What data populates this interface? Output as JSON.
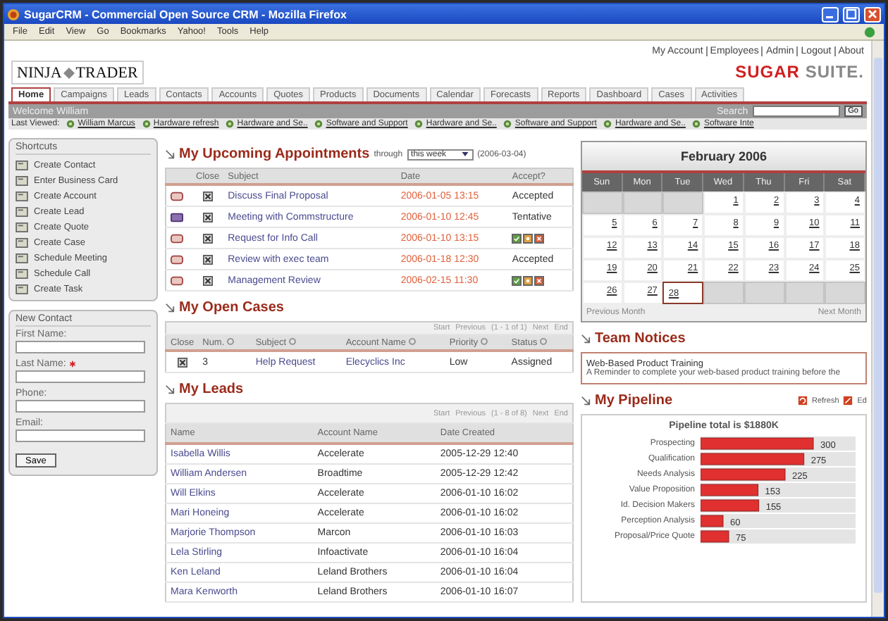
{
  "window": {
    "title": "SugarCRM - Commercial Open Source CRM - Mozilla Firefox"
  },
  "menu": [
    "File",
    "Edit",
    "View",
    "Go",
    "Bookmarks",
    "Yahoo!",
    "Tools",
    "Help"
  ],
  "logo": {
    "left": "NINJA",
    "right": "TRADER"
  },
  "header_links": [
    "My Account",
    "Employees",
    "Admin",
    "Logout",
    "About"
  ],
  "brand": {
    "strong": "SUGAR",
    "light": "SUITE."
  },
  "tabs": [
    {
      "label": "Home",
      "selected": true
    },
    {
      "label": "Campaigns",
      "selected": false
    },
    {
      "label": "Leads",
      "selected": false
    },
    {
      "label": "Contacts",
      "selected": false
    },
    {
      "label": "Accounts",
      "selected": false
    },
    {
      "label": "Quotes",
      "selected": false
    },
    {
      "label": "Products",
      "selected": false
    },
    {
      "label": "Documents",
      "selected": false
    },
    {
      "label": "Calendar",
      "selected": false
    },
    {
      "label": "Forecasts",
      "selected": false
    },
    {
      "label": "Reports",
      "selected": false
    },
    {
      "label": "Dashboard",
      "selected": false
    },
    {
      "label": "Cases",
      "selected": false
    },
    {
      "label": "Activities",
      "selected": false
    }
  ],
  "welcome": {
    "text": "Welcome William",
    "search_label": "Search",
    "go": "Go"
  },
  "last_viewed": {
    "label": "Last Viewed:",
    "items": [
      "William Marcus",
      "Hardware refresh",
      "Hardware and Se..",
      "Software and Support",
      "Hardware and Se..",
      "Software and Support",
      "Hardware and Se..",
      "Software Inte"
    ]
  },
  "shortcuts": {
    "title": "Shortcuts",
    "items": [
      "Create Contact",
      "Enter Business Card",
      "Create Account",
      "Create Lead",
      "Create Quote",
      "Create Case",
      "Schedule Meeting",
      "Schedule Call",
      "Create Task"
    ]
  },
  "new_contact": {
    "title": "New Contact",
    "fields": [
      {
        "label": "First Name:",
        "required": false
      },
      {
        "label": "Last Name:",
        "required": true
      },
      {
        "label": "Phone:",
        "required": false
      },
      {
        "label": "Email:",
        "required": false
      }
    ],
    "save": "Save"
  },
  "appointments": {
    "title": "My Upcoming Appointments",
    "through": "through",
    "range": "this week",
    "until": "(2006-03-04)",
    "columns": [
      "Close",
      "Subject",
      "Date",
      "Accept?"
    ],
    "rows": [
      {
        "kind": "call",
        "subject": "Discuss Final Proposal",
        "date": "2006-01-05 13:15",
        "accept": {
          "kind": "text",
          "label": "Accepted"
        }
      },
      {
        "kind": "meeting",
        "subject": "Meeting with Commstructure",
        "date": "2006-01-10 12:45",
        "accept": {
          "kind": "text",
          "label": "Tentative"
        }
      },
      {
        "kind": "call",
        "subject": "Request for Info Call",
        "date": "2006-01-10 13:15",
        "accept": {
          "kind": "buttons"
        }
      },
      {
        "kind": "call",
        "subject": "Review with exec team",
        "date": "2006-01-18 12:30",
        "accept": {
          "kind": "text",
          "label": "Accepted"
        }
      },
      {
        "kind": "call",
        "subject": "Management Review",
        "date": "2006-02-15 11:30",
        "accept": {
          "kind": "buttons"
        }
      }
    ]
  },
  "open_cases": {
    "title": "My Open Cases",
    "pager": [
      "Start",
      "Previous",
      "(1 - 1 of 1)",
      "Next",
      "End"
    ],
    "columns": [
      "Close",
      "Num.",
      "Subject",
      "Account Name",
      "Priority",
      "Status"
    ],
    "rows": [
      {
        "num": "3",
        "subject": "Help Request",
        "account": "Elecyclics Inc",
        "priority": "Low",
        "status": "Assigned"
      }
    ]
  },
  "leads": {
    "title": "My Leads",
    "pager": [
      "Start",
      "Previous",
      "(1 - 8 of 8)",
      "Next",
      "End"
    ],
    "columns": [
      "Name",
      "Account Name",
      "Date Created"
    ],
    "rows": [
      {
        "name": "Isabella Willis",
        "account": "Accelerate",
        "date": "2005-12-29 12:40"
      },
      {
        "name": "William Andersen",
        "account": "Broadtime",
        "date": "2005-12-29 12:42"
      },
      {
        "name": "Will Elkins",
        "account": "Accelerate",
        "date": "2006-01-10 16:02"
      },
      {
        "name": "Mari Honeing",
        "account": "Accelerate",
        "date": "2006-01-10 16:02"
      },
      {
        "name": "Marjorie Thompson",
        "account": "Marcon",
        "date": "2006-01-10 16:03"
      },
      {
        "name": "Lela Stirling",
        "account": "Infoactivate",
        "date": "2006-01-10 16:04"
      },
      {
        "name": "Ken Leland",
        "account": "Leland Brothers",
        "date": "2006-01-10 16:04"
      },
      {
        "name": "Mara Kenworth",
        "account": "Leland Brothers",
        "date": "2006-01-10 16:07"
      }
    ]
  },
  "calendar": {
    "title": "February 2006",
    "weekdays": [
      "Sun",
      "Mon",
      "Tue",
      "Wed",
      "Thu",
      "Fri",
      "Sat"
    ],
    "weeks": [
      [
        {
          "kind": "blank"
        },
        {
          "kind": "blank"
        },
        {
          "kind": "blank"
        },
        {
          "label": "1",
          "selected": false
        },
        {
          "label": "2",
          "selected": false
        },
        {
          "label": "3",
          "selected": false
        },
        {
          "label": "4",
          "selected": false
        }
      ],
      [
        {
          "label": "5",
          "selected": false
        },
        {
          "label": "6",
          "selected": false
        },
        {
          "label": "7",
          "selected": false
        },
        {
          "label": "8",
          "selected": false
        },
        {
          "label": "9",
          "selected": false
        },
        {
          "label": "10",
          "selected": false
        },
        {
          "label": "11",
          "selected": false
        }
      ],
      [
        {
          "label": "12",
          "selected": false
        },
        {
          "label": "13",
          "selected": false
        },
        {
          "label": "14",
          "selected": false
        },
        {
          "label": "15",
          "selected": false
        },
        {
          "label": "16",
          "selected": false
        },
        {
          "label": "17",
          "selected": false
        },
        {
          "label": "18",
          "selected": false
        }
      ],
      [
        {
          "label": "19",
          "selected": false
        },
        {
          "label": "20",
          "selected": false
        },
        {
          "label": "21",
          "selected": false
        },
        {
          "label": "22",
          "selected": false
        },
        {
          "label": "23",
          "selected": false
        },
        {
          "label": "24",
          "selected": false
        },
        {
          "label": "25",
          "selected": false
        }
      ],
      [
        {
          "label": "26",
          "selected": false
        },
        {
          "label": "27",
          "selected": false
        },
        {
          "label": "28",
          "selected": true
        },
        {
          "kind": "blank"
        },
        {
          "kind": "blank"
        },
        {
          "kind": "blank"
        },
        {
          "kind": "blank"
        }
      ]
    ],
    "previous": "Previous Month",
    "next": "Next Month"
  },
  "team_notices": {
    "title": "Team Notices",
    "notice_title": "Web-Based Product Training",
    "notice_text": "A Reminder to complete your web-based product training before the"
  },
  "pipeline": {
    "title": "My Pipeline",
    "refresh": "Refresh",
    "edit": "Ed",
    "chart_data": {
      "type": "bar",
      "orientation": "horizontal",
      "title": "Pipeline total is $1880K",
      "categories": [
        "Prospecting",
        "Qualification",
        "Needs Analysis",
        "Value Proposition",
        "Id. Decision Makers",
        "Perception Analysis",
        "Proposal/Price Quote"
      ],
      "series": [
        {
          "color": "#e03030",
          "values": [
            300,
            275,
            225,
            153,
            155,
            60,
            75
          ]
        }
      ],
      "data_labels": true
    }
  }
}
